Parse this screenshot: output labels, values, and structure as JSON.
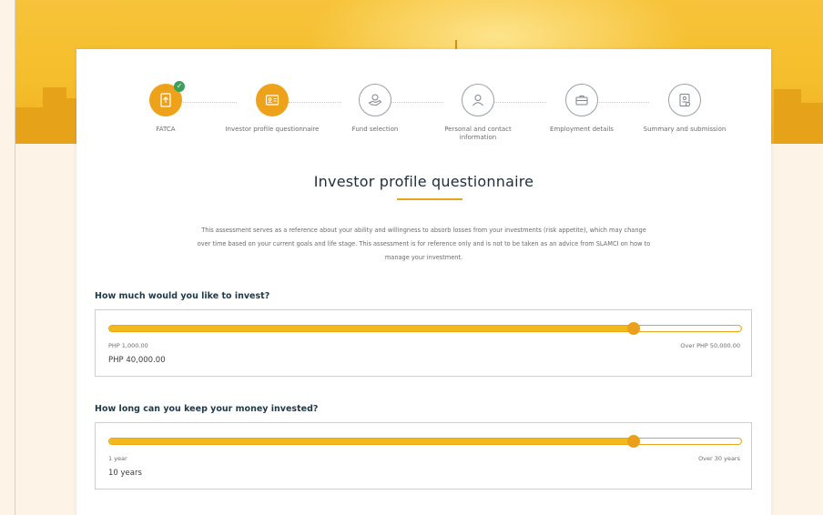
{
  "stepper": {
    "steps": [
      {
        "label": "FATCA",
        "state": "completed",
        "icon": "document-upload-icon"
      },
      {
        "label": "Investor profile questionnaire",
        "state": "active",
        "icon": "id-card-icon"
      },
      {
        "label": "Fund selection",
        "state": "todo",
        "icon": "hand-coins-icon"
      },
      {
        "label": "Personal and contact information",
        "state": "todo",
        "icon": "user-icon"
      },
      {
        "label": "Employment details",
        "state": "todo",
        "icon": "briefcase-icon"
      },
      {
        "label": "Summary and submission",
        "state": "todo",
        "icon": "document-check-icon"
      }
    ]
  },
  "page": {
    "title": "Investor profile questionnaire",
    "intro": "This assessment serves as a reference about your ability and willingness to absorb losses from your investments (risk appetite), which may change over time based on your current goals and life stage. This assessment is for reference only and is not to be taken as an advice from SLAMCI on how to manage your investment."
  },
  "questions": [
    {
      "question": "How much would you like to invest?",
      "min_label": "PHP 1,000.00",
      "max_label": "Over PHP 50,000.00",
      "value_label": "PHP 40,000.00",
      "fill_fraction": 0.83
    },
    {
      "question": "How long can you keep your money invested?",
      "min_label": "1 year",
      "max_label": "Over 30 years",
      "value_label": "10 years",
      "fill_fraction": 0.83
    }
  ],
  "colors": {
    "accent": "#eea21a",
    "banner": "#f5be2c",
    "heading": "#1d3a4a",
    "completed": "#3aa15a"
  }
}
